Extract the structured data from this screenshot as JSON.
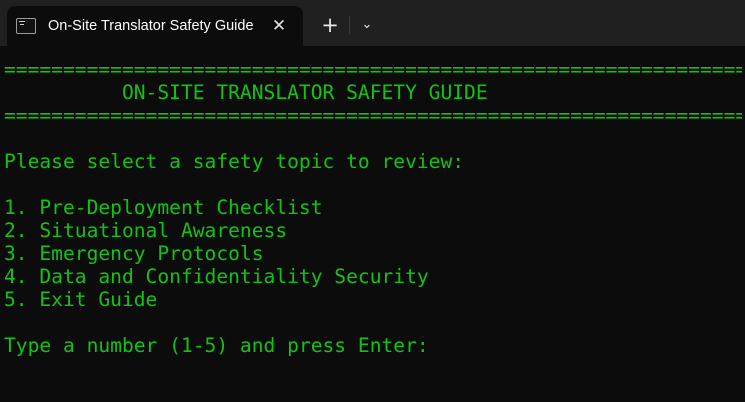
{
  "tab": {
    "title": "On-Site Translator Safety Guide",
    "close_glyph": "✕"
  },
  "tabbar": {
    "new_tab_glyph": "+",
    "dropdown_glyph": "⌄"
  },
  "terminal": {
    "text_color": "#13c313",
    "rule": "====================================================================================================",
    "rule_chars": 73,
    "heading": "          ON-SITE TRANSLATOR SAFETY GUIDE",
    "prompt_intro": "Please select a safety topic to review:",
    "options": [
      "1. Pre-Deployment Checklist",
      "2. Situational Awareness",
      "3. Emergency Protocols",
      "4. Data and Confidentiality Security",
      "5. Exit Guide"
    ],
    "input_prompt": "Type a number (1-5) and press Enter:"
  }
}
